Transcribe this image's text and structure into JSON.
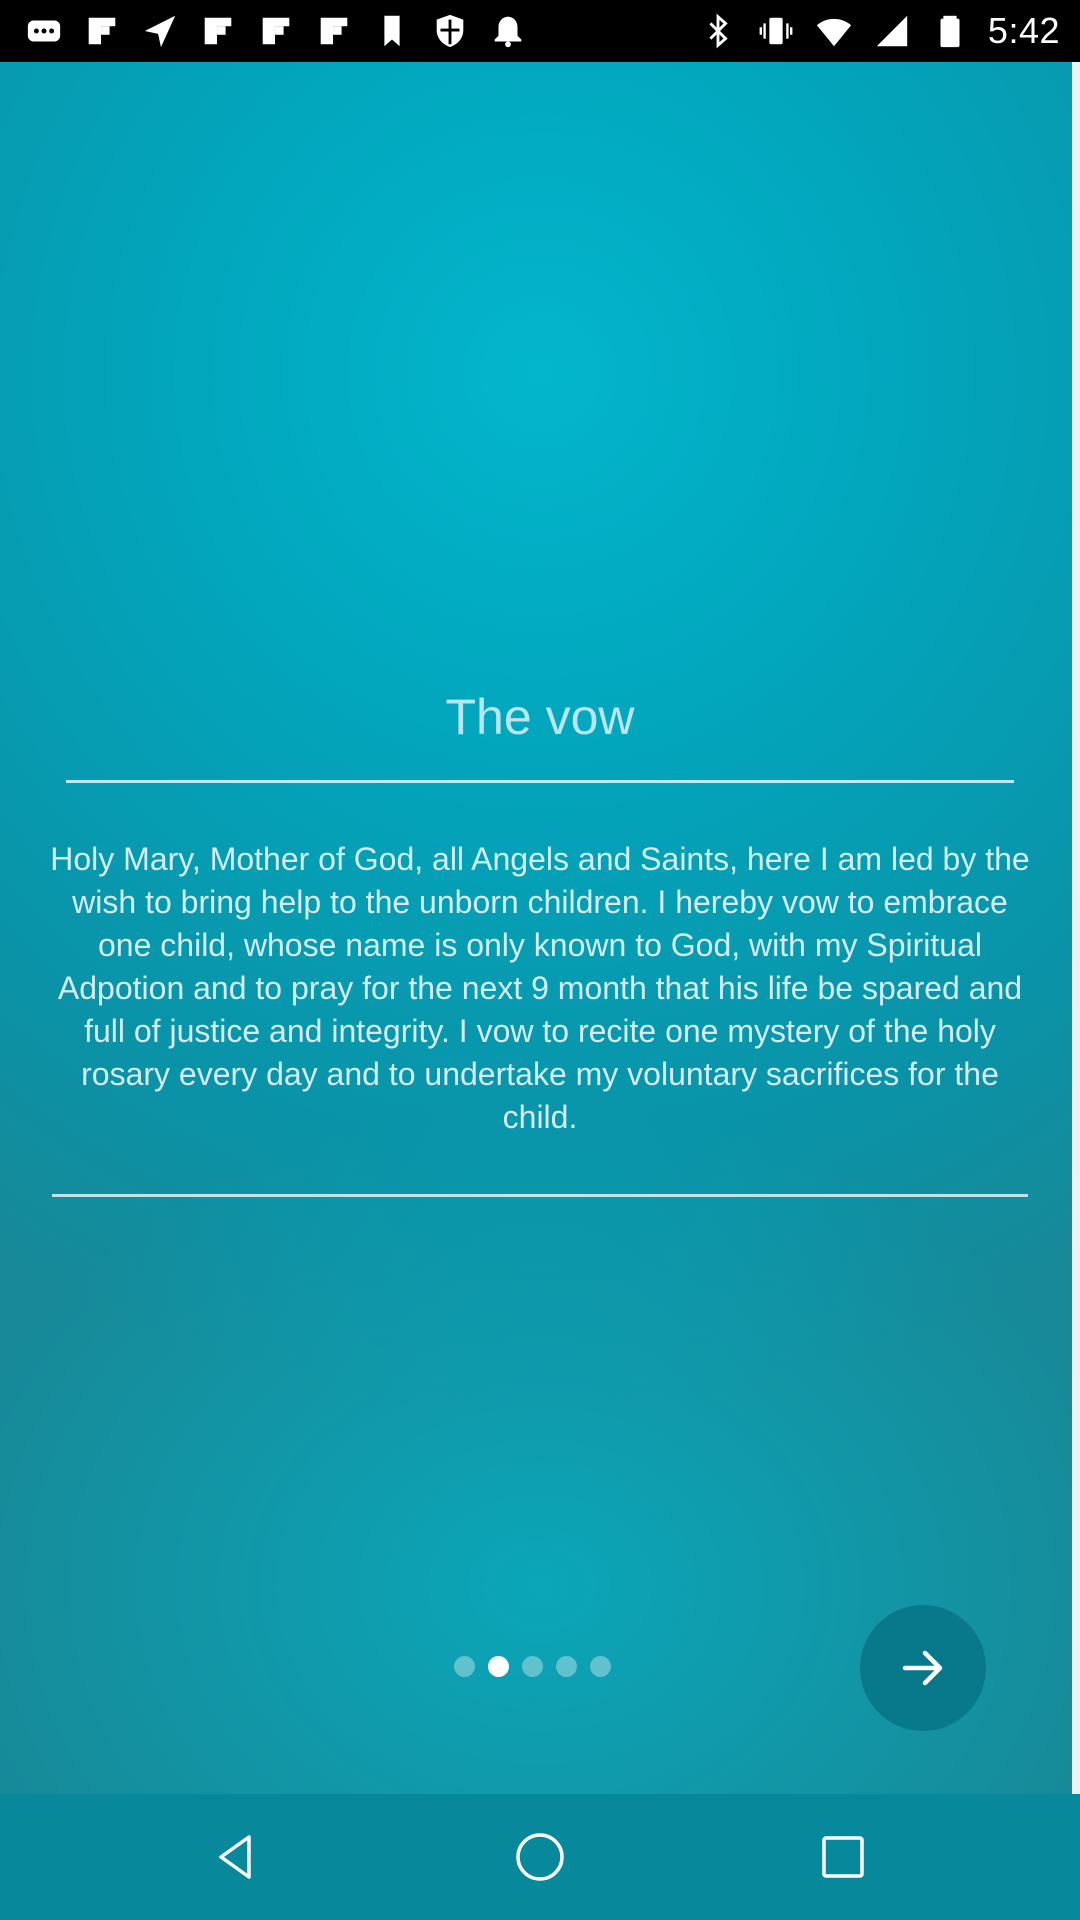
{
  "status_bar": {
    "time": "5:42",
    "left_icons": [
      "messaging-icon",
      "flipboard-icon",
      "send-icon",
      "flipboard-icon",
      "flipboard-icon",
      "flipboard-icon",
      "bookmark-icon",
      "shield-icon",
      "bell-icon"
    ],
    "right_icons": [
      "bluetooth-icon",
      "vibrate-icon",
      "wifi-icon",
      "signal-icon",
      "battery-icon"
    ]
  },
  "main": {
    "title": "The vow",
    "body": "Holy Mary, Mother of God, all Angels and Saints, here I am led by the wish to bring help to the unborn children. I hereby vow to embrace one child, whose name is only known to God, with my Spiritual Adpotion and to pray for the next 9 month that his life be spared and full of justice and integrity. I vow to recite one mystery of the holy rosary every day and to undertake my voluntary sacrifices for the child."
  },
  "pager": {
    "total_pages": 5,
    "current_page": 2
  },
  "next_button": {
    "icon": "arrow-right-icon"
  },
  "nav_bar": {
    "back_icon": "back-triangle-icon",
    "home_icon": "home-circle-icon",
    "recents_icon": "recents-square-icon"
  },
  "colors": {
    "background_top": "#03b6cc",
    "background_mid": "#0aa2b7",
    "next_button": "#08798a",
    "nav_bar": "#08899b",
    "text": "#ffffff"
  }
}
